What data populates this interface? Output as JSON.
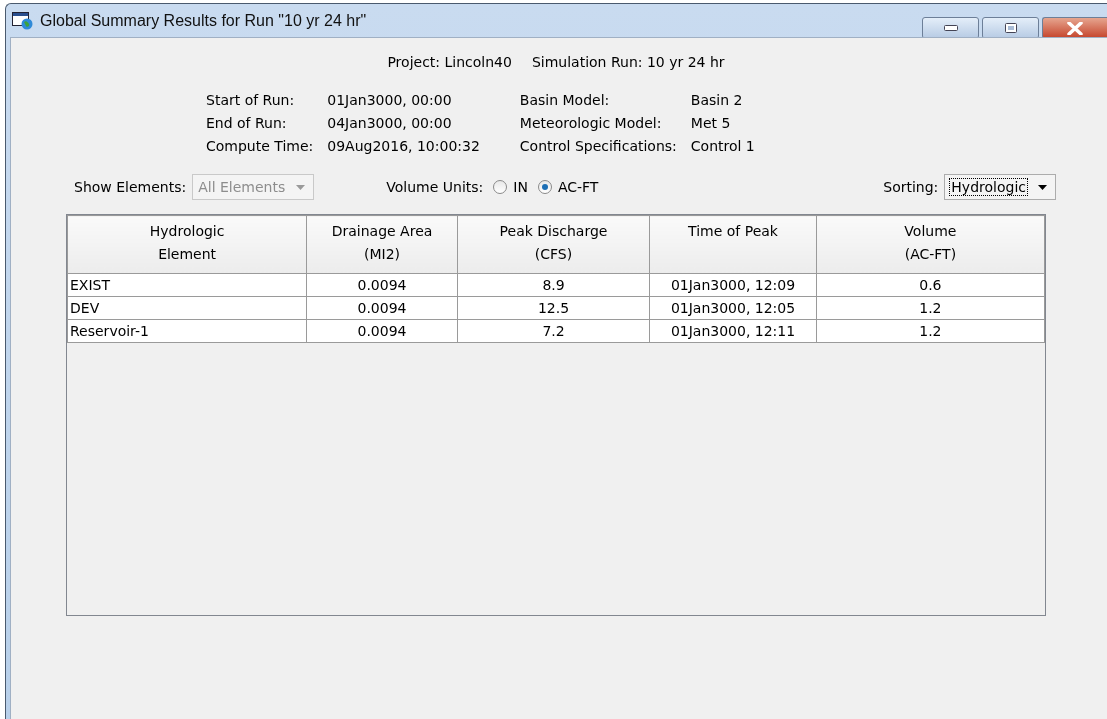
{
  "window": {
    "title": "Global Summary Results for Run \"10 yr 24 hr\""
  },
  "summary": {
    "project": "Project: Lincoln40",
    "simulation_run": "Simulation Run: 10 yr 24 hr"
  },
  "run_info": [
    {
      "label": "Start of Run:",
      "value": "01Jan3000, 00:00"
    },
    {
      "label": "End of Run:",
      "value": "04Jan3000, 00:00"
    },
    {
      "label": "Compute Time:",
      "value": "09Aug2016, 10:00:32"
    }
  ],
  "model_info": [
    {
      "label": "Basin Model:",
      "value": "Basin 2"
    },
    {
      "label": "Meteorologic Model:",
      "value": "Met 5"
    },
    {
      "label": "Control Specifications:",
      "value": "Control 1"
    }
  ],
  "show_elements": {
    "label": "Show Elements:",
    "value": "All Elements",
    "disabled": true
  },
  "volume_units": {
    "label": "Volume Units:",
    "options": [
      {
        "label": "IN",
        "selected": false
      },
      {
        "label": "AC-FT",
        "selected": true
      }
    ]
  },
  "sorting": {
    "label": "Sorting:",
    "value": "Hydrologic",
    "disabled": false
  },
  "table": {
    "columns": [
      "Hydrologic\nElement",
      "Drainage Area\n(MI2)",
      "Peak Discharge\n(CFS)",
      "Time of Peak",
      "Volume\n(AC-FT)"
    ],
    "rows": [
      [
        "EXIST",
        "0.0094",
        "8.9",
        "01Jan3000, 12:09",
        "0.6"
      ],
      [
        "DEV",
        "0.0094",
        "12.5",
        "01Jan3000, 12:05",
        "1.2"
      ],
      [
        "Reservoir-1",
        "0.0094",
        "7.2",
        "01Jan3000, 12:11",
        "1.2"
      ]
    ]
  }
}
